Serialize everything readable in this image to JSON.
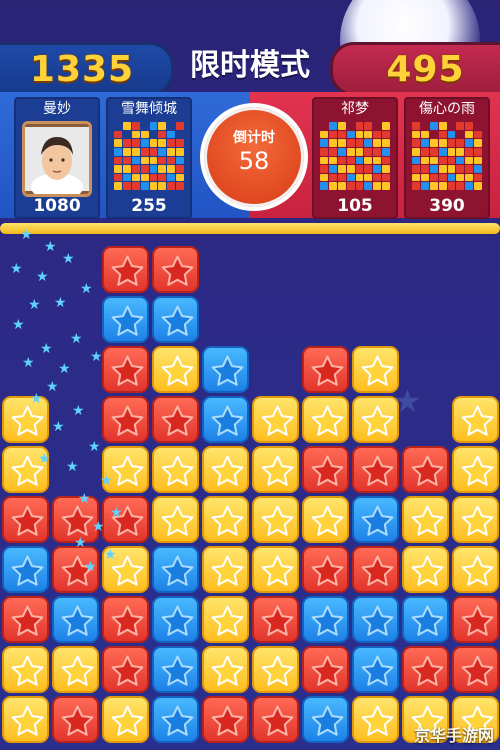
{
  "header": {
    "left_score": "1335",
    "title": "限时模式",
    "right_score": "495"
  },
  "timer": {
    "label": "倒计时",
    "value": "58"
  },
  "players": [
    {
      "name": "曼妙",
      "score": "1080",
      "team": "blue",
      "type": "avatar"
    },
    {
      "name": "雪舞倾城",
      "score": "255",
      "team": "blue",
      "type": "board"
    },
    {
      "name": "祁梦",
      "score": "105",
      "team": "red",
      "type": "board"
    },
    {
      "name": "傷心の雨",
      "score": "390",
      "team": "red",
      "type": "board"
    }
  ],
  "progress": {
    "fraction": 1.0
  },
  "board": {
    "columns": 10,
    "rows_top_to_bottom": [
      "..rr......",
      "..bb......",
      "..ryb.ry..",
      "y.rrbyyy.y",
      "y.yyyyrrry",
      "rrryyyybyy",
      "brybyyrryy",
      "rbrbyrbbbr",
      "yyrbyyrbrr",
      "yrybrrbyyy"
    ],
    "colors": {
      "r": "#e23a2e",
      "y": "#ffc526",
      "b": "#2290ee"
    }
  },
  "watermark": "京华手游网"
}
